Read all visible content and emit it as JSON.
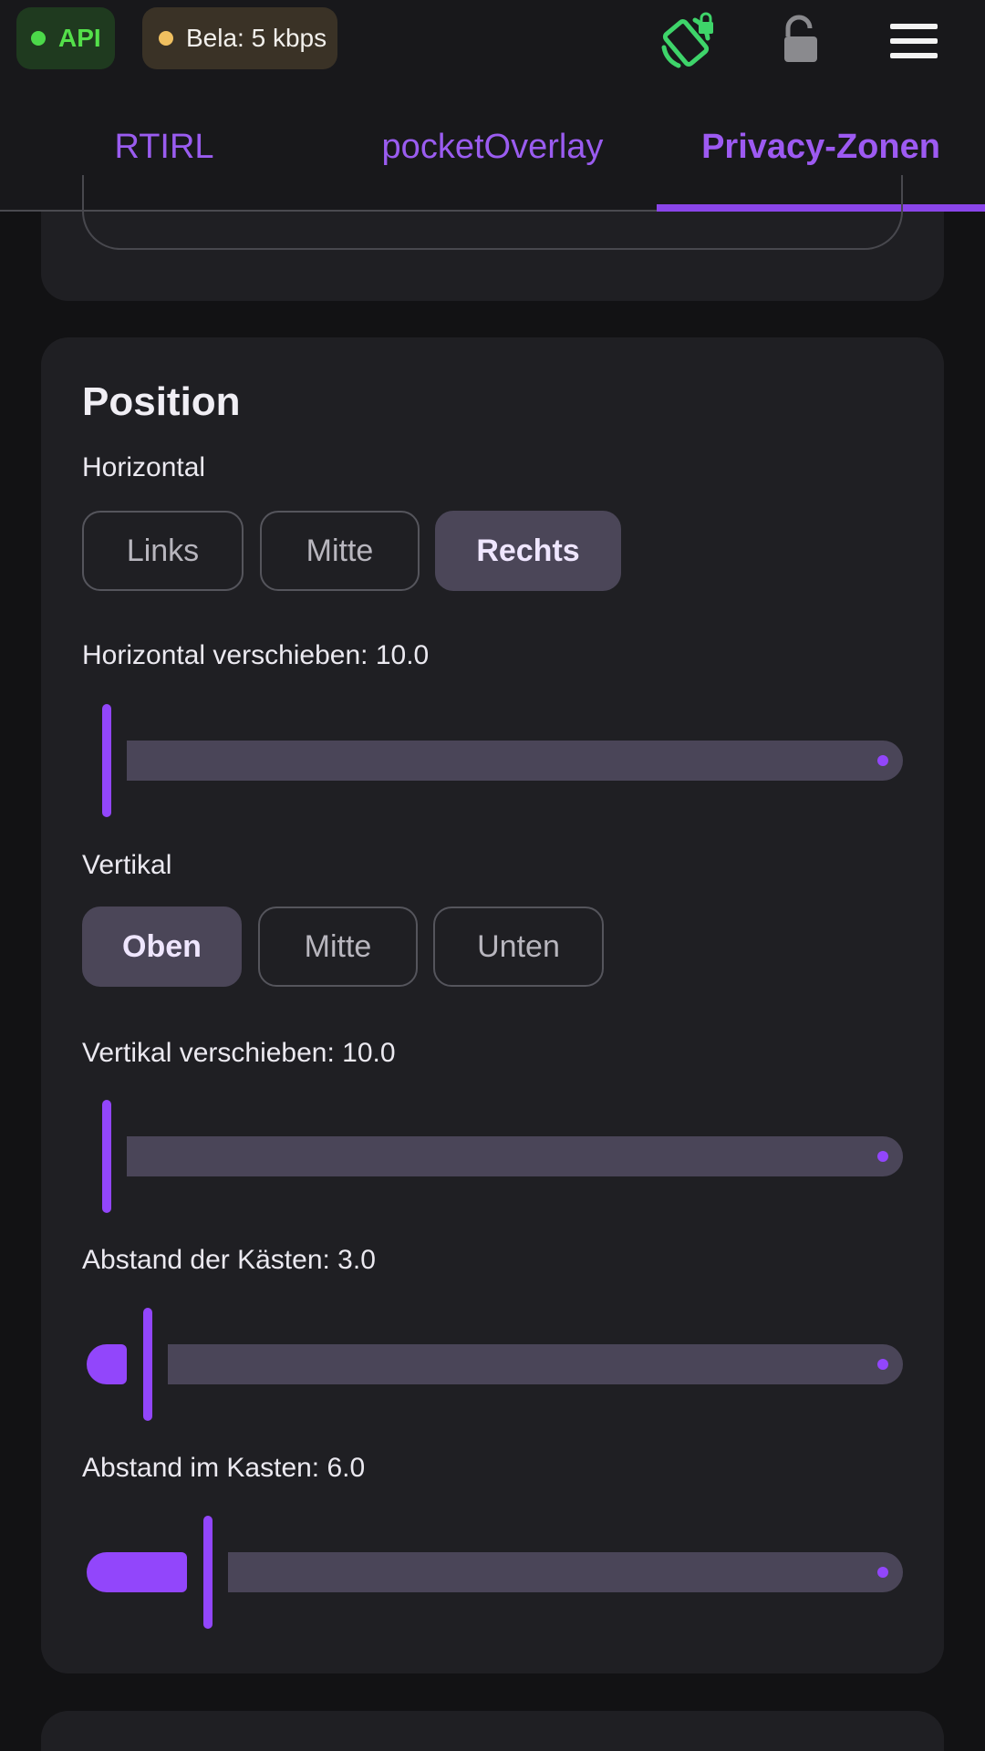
{
  "status": {
    "api_label": "API",
    "bela_label": "Bela: 5 kbps",
    "colors": {
      "api_dot": "#4cd94a",
      "bela_dot": "#f0c060"
    }
  },
  "icons": {
    "rotate": "screen-rotation-lock-icon",
    "lock": "unlocked-padlock-icon",
    "menu": "hamburger-menu-icon"
  },
  "tabs": [
    {
      "label": "RTIRL",
      "selected": false
    },
    {
      "label": "pocketOverlay",
      "selected": false
    },
    {
      "label": "Privacy-Zonen",
      "selected": true
    }
  ],
  "position": {
    "title": "Position",
    "horizontal_label": "Horizontal",
    "horizontal_options": [
      "Links",
      "Mitte",
      "Rechts"
    ],
    "horizontal_selected": "Rechts",
    "horizontal_shift_label": "Horizontal verschieben: 10.0",
    "horizontal_shift_value": 0,
    "vertical_label": "Vertikal",
    "vertical_options": [
      "Oben",
      "Mitte",
      "Unten"
    ],
    "vertical_selected": "Oben",
    "vertical_shift_label": "Vertikal verschieben: 10.0",
    "vertical_shift_value": 0,
    "box_gap_label": "Abstand der Kästen: 3.0",
    "box_gap_fraction": 0.05,
    "inner_gap_label": "Abstand im Kasten: 6.0",
    "inner_gap_fraction": 0.12
  },
  "accent_color": "#9246fb"
}
